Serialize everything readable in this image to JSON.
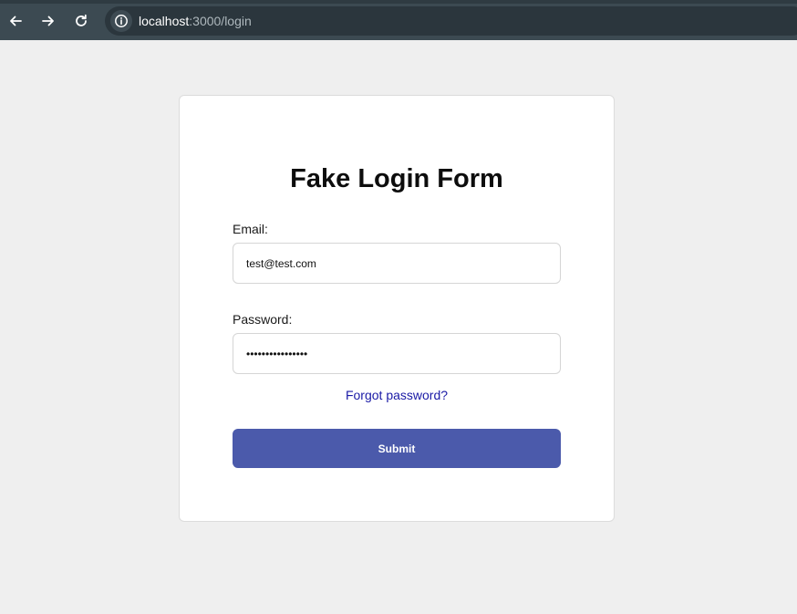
{
  "browser": {
    "url_host": "localhost",
    "url_path": ":3000/login",
    "icons": [
      "back-arrow-icon",
      "forward-arrow-icon",
      "reload-icon",
      "site-info-icon"
    ]
  },
  "form": {
    "title": "Fake Login Form",
    "email_label": "Email:",
    "email_value": "test@test.com",
    "password_label": "Password:",
    "password_value": "••••••••••••••••",
    "forgot_link": "Forgot password?",
    "submit_label": "Submit"
  },
  "colors": {
    "page_background": "#efefef",
    "browser_bar": "#3c4a52",
    "card_background": "#ffffff",
    "submit_button": "#4b5aab",
    "link": "#1a1aa6"
  }
}
